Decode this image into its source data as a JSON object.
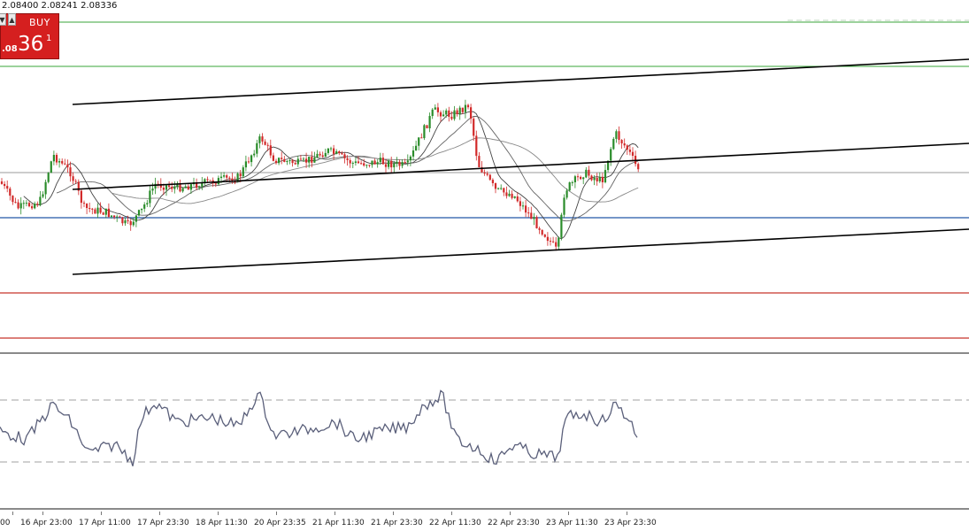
{
  "quote": {
    "ohlc_text": "2.08400 2.08241 2.08336"
  },
  "trade_panel": {
    "buy_label": "BUY",
    "price_small": ".08",
    "price_big": "36",
    "price_sup": "1",
    "down_arrow": "▼",
    "up_arrow": "▲"
  },
  "time_axis": {
    "labels": [
      "00",
      "16 Apr 23:00",
      "17 Apr 11:00",
      "17 Apr 23:30",
      "18 Apr 11:30",
      "20 Apr 23:35",
      "21 Apr 11:30",
      "21 Apr 23:30",
      "22 Apr 11:30",
      "22 Apr 23:30",
      "23 Apr 11:30",
      "23 Apr 23:30"
    ]
  },
  "colors": {
    "background": "#ffffff",
    "bull": "#2a8c2a",
    "bear": "#d22a2a",
    "channel": "#000000",
    "ma": "#555555",
    "green_level": "#3aa63a",
    "blue_level": "#2357a8",
    "red_level": "#c8342a",
    "indicator": "#5a5f7a",
    "buy_button": "#d51f1f"
  }
}
